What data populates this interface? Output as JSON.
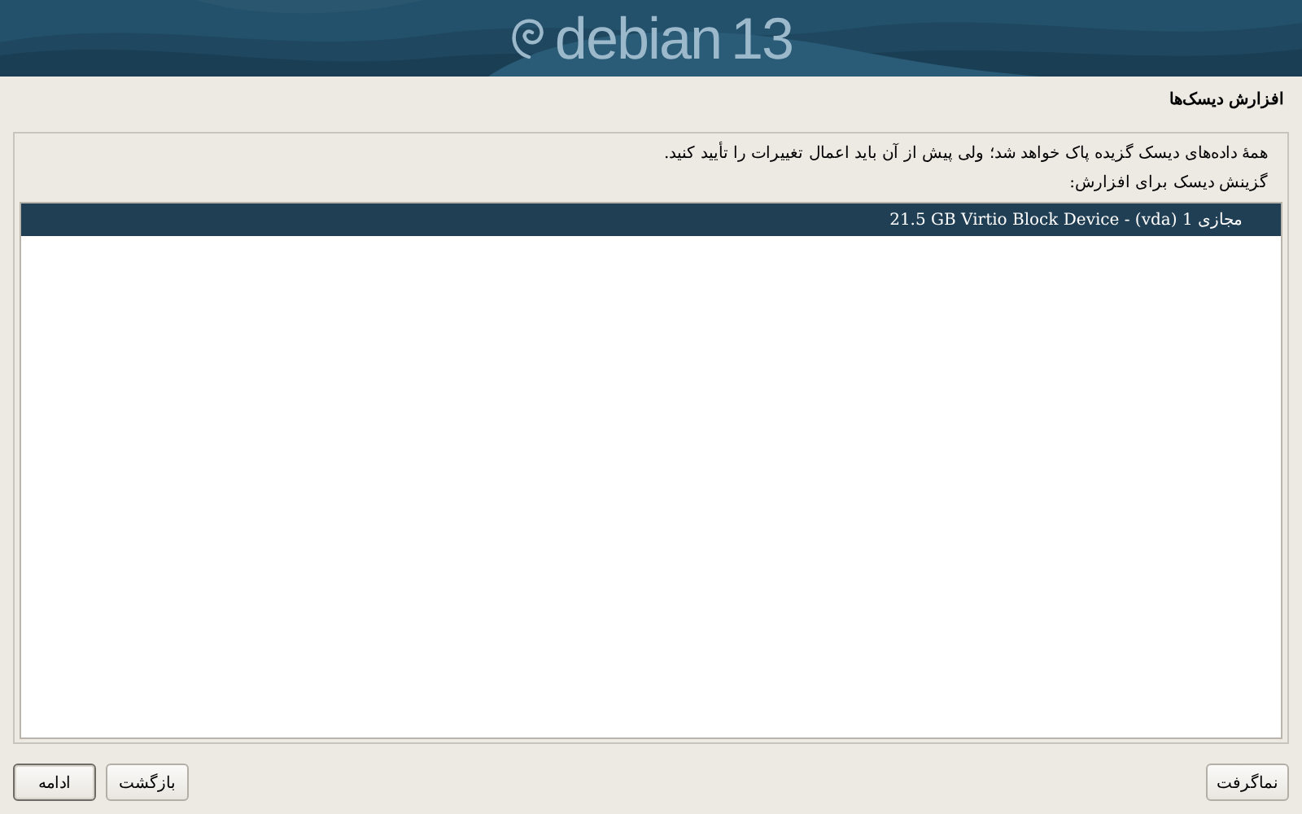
{
  "banner": {
    "logo_text": "debian",
    "logo_version": "13"
  },
  "title": "افزارش دیسک‌ها",
  "message": "همهٔ داده‌های دیسک گزیده پاک خواهد شد؛ ولی پیش از آن باید اعمال تغییرات را تأیید کنید.",
  "prompt": "گزینش دیسک برای افزارش:",
  "disks": [
    {
      "label": "مجازی 1 (vda) - 21.5 GB Virtio Block Device",
      "selected": true
    }
  ],
  "right_buttons": [
    {
      "label": "نماگرفت",
      "focused": false
    }
  ],
  "left_buttons": [
    {
      "label": "بازگشت",
      "focused": false
    },
    {
      "label": "ادامه",
      "focused": true
    }
  ]
}
